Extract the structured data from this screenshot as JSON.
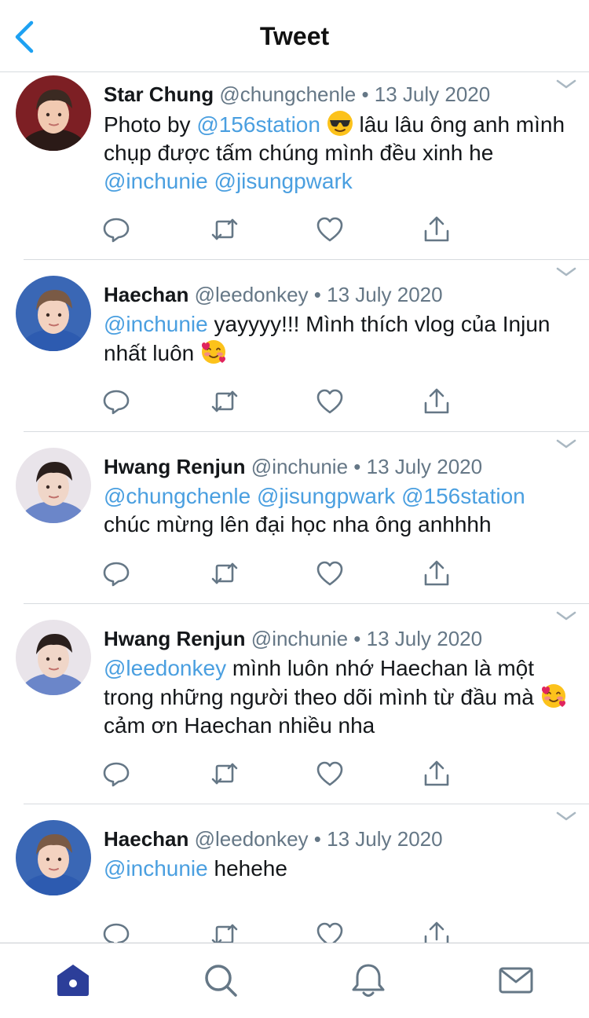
{
  "header": {
    "title": "Tweet",
    "back_icon": "chevron-left-icon"
  },
  "colors": {
    "accent": "#1DA1F2",
    "mention": "#4A9FE0",
    "text": "#14171A",
    "secondary": "#657786",
    "tab_active": "#2C3E99"
  },
  "tweets": [
    {
      "name": "Star Chung",
      "handle": "@chungchenle",
      "dot": "•",
      "date": "13 July 2020",
      "segments": [
        {
          "type": "text",
          "value": "Photo by "
        },
        {
          "type": "mention",
          "value": "@156station"
        },
        {
          "type": "text",
          "value": " "
        },
        {
          "type": "emoji",
          "value": "sunglasses"
        },
        {
          "type": "text",
          "value": " lâu lâu ông anh mình chụp được tấm chúng mình đều xinh he "
        },
        {
          "type": "mention",
          "value": "@inchunie"
        },
        {
          "type": "text",
          "value": " "
        },
        {
          "type": "mention",
          "value": "@jisungpwark"
        }
      ]
    },
    {
      "name": "Haechan",
      "handle": "@leedonkey",
      "dot": "•",
      "date": "13 July 2020",
      "segments": [
        {
          "type": "mention",
          "value": "@inchunie"
        },
        {
          "type": "text",
          "value": " yayyyy!!! Mình thích vlog của Injun nhất luôn "
        },
        {
          "type": "emoji",
          "value": "smiling-face-with-hearts"
        }
      ]
    },
    {
      "name": "Hwang Renjun",
      "handle": "@inchunie",
      "dot": "•",
      "date": "13 July 2020",
      "segments": [
        {
          "type": "mention",
          "value": "@chungchenle"
        },
        {
          "type": "text",
          "value": " "
        },
        {
          "type": "mention",
          "value": "@jisungpwark"
        },
        {
          "type": "text",
          "value": " "
        },
        {
          "type": "mention",
          "value": "@156station"
        },
        {
          "type": "text",
          "value": " chúc mừng lên đại học nha ông anhhhh"
        }
      ]
    },
    {
      "name": "Hwang Renjun",
      "handle": "@inchunie",
      "dot": "•",
      "date": "13 July 2020",
      "segments": [
        {
          "type": "mention",
          "value": "@leedonkey"
        },
        {
          "type": "text",
          "value": " mình luôn nhớ Haechan là một trong những người theo dõi mình từ đầu mà "
        },
        {
          "type": "emoji",
          "value": "smiling-face-with-hearts"
        },
        {
          "type": "text",
          "value": " cảm ơn Haechan nhiều nha"
        }
      ]
    },
    {
      "name": "Haechan",
      "handle": "@leedonkey",
      "dot": "•",
      "date": "13 July 2020",
      "segments": [
        {
          "type": "mention",
          "value": "@inchunie"
        },
        {
          "type": "text",
          "value": " hehehe"
        }
      ]
    }
  ],
  "tweet_actions": [
    "reply-icon",
    "retweet-icon",
    "like-icon",
    "share-icon"
  ],
  "tabbar": [
    "home-icon",
    "search-icon",
    "notifications-icon",
    "messages-icon"
  ]
}
